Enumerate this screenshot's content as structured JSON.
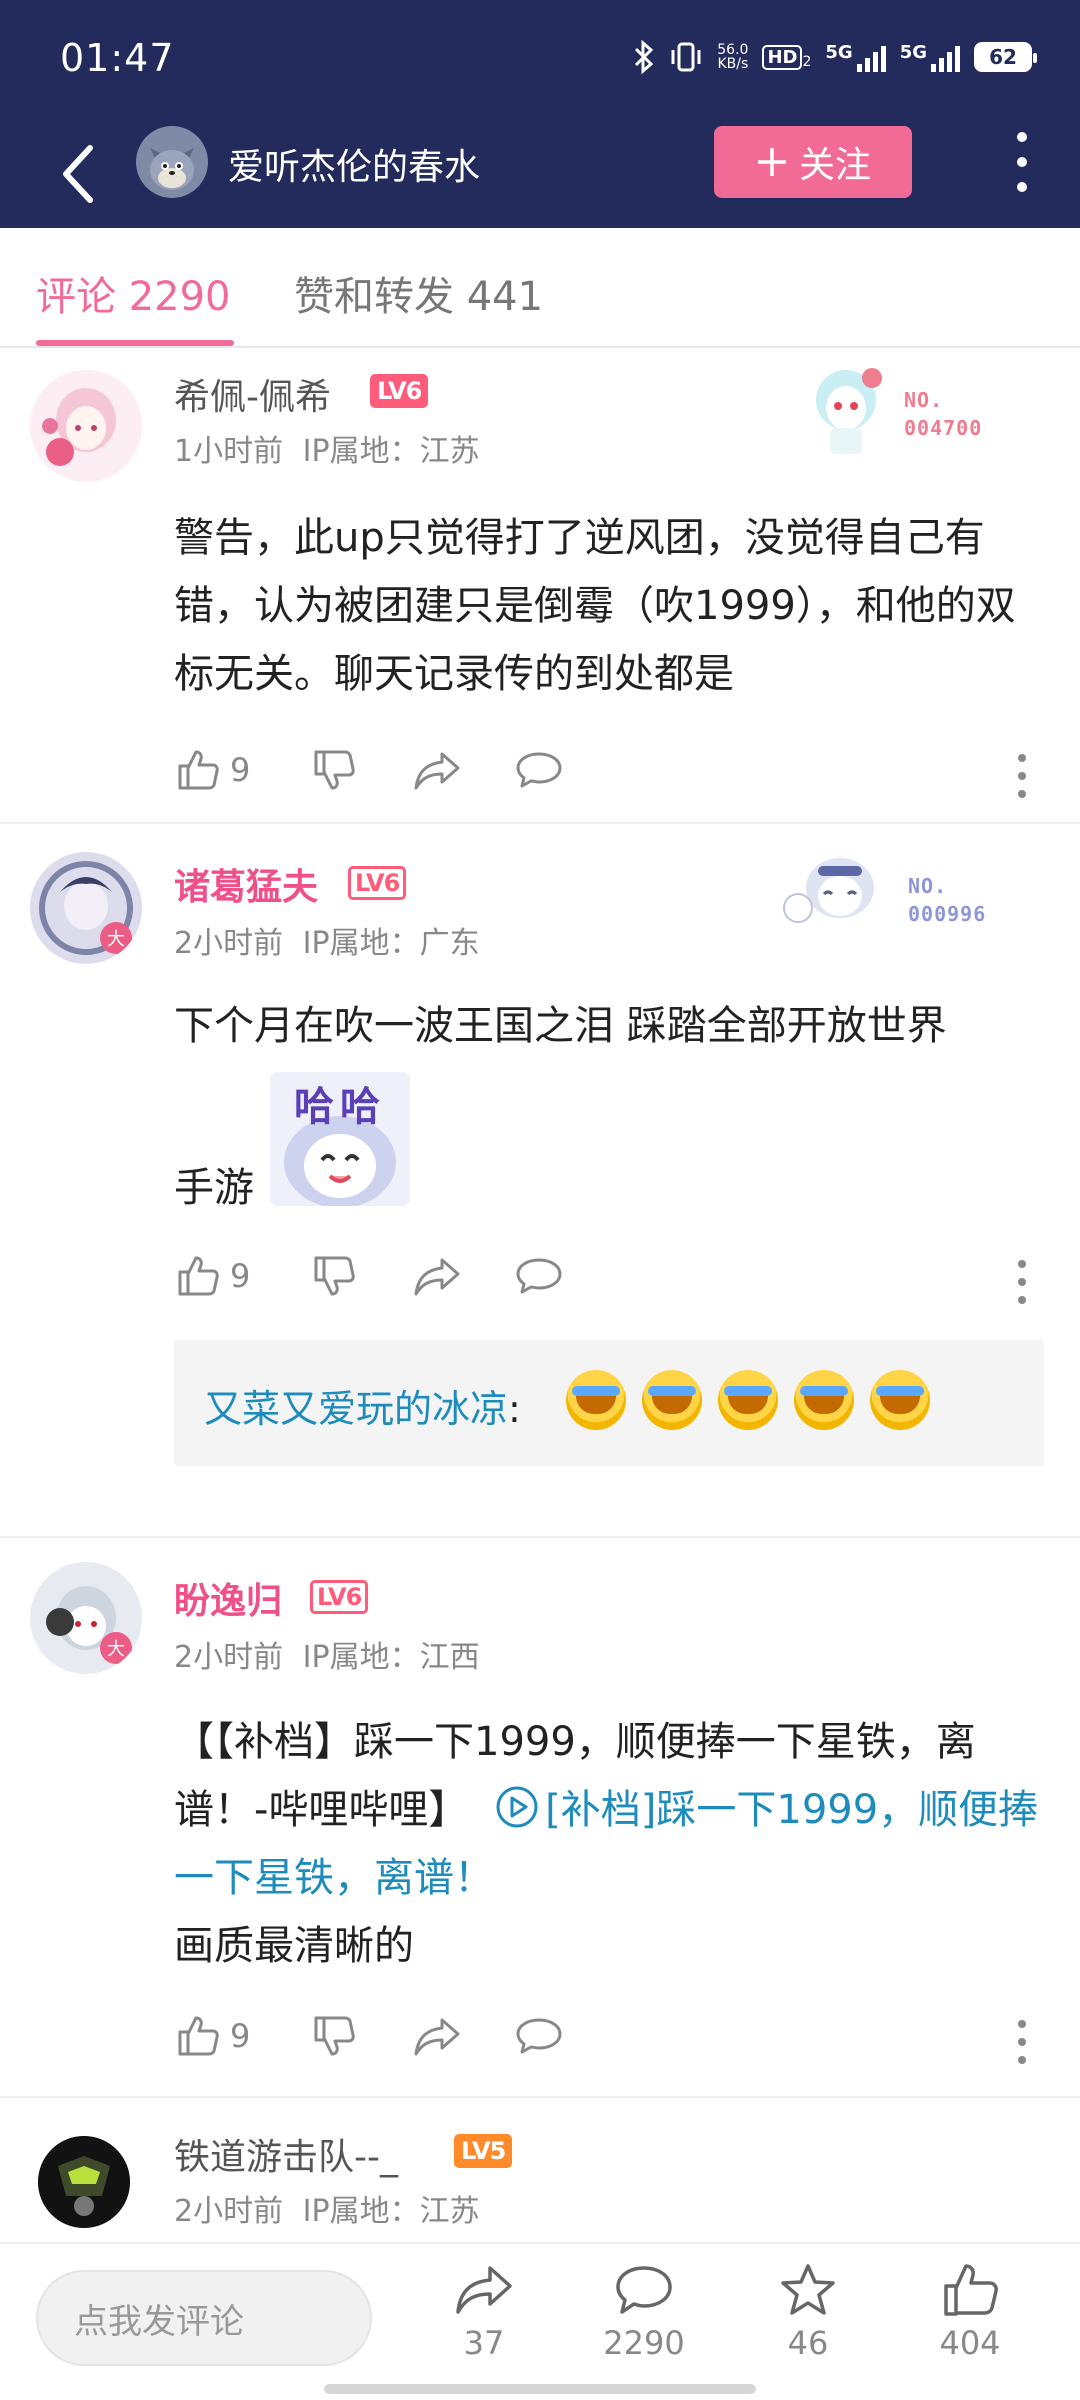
{
  "status_bar": {
    "time": "01:47",
    "net_speed_value": "56.0",
    "net_speed_unit": "KB/s",
    "hd_label": "HD",
    "hd_sub": "2",
    "net1": "5G",
    "net2": "5G",
    "battery": "62"
  },
  "header": {
    "user_name": "爱听杰伦的春水",
    "follow_label": "关注"
  },
  "tabs": [
    {
      "label": "评论 2290",
      "active": true
    },
    {
      "label": "赞和转发 441",
      "active": false
    }
  ],
  "comments": [
    {
      "user": "希佩-佩希",
      "level": "LV6",
      "time": "1小时前",
      "ip": "IP属地：江苏",
      "badge_no": "NO.",
      "badge_num": "004700",
      "text": "警告，此up只觉得打了逆风团，没觉得自己有错，认为被团建只是倒霉（吹1999），和他的双标无关。聊天记录传的到处都是",
      "likes": "9"
    },
    {
      "user": "诸葛猛夫",
      "level": "LV6",
      "time": "2小时前",
      "ip": "IP属地：广东",
      "badge_no": "NO.",
      "badge_num": "000996",
      "text_line1": "下个月在吹一波王国之泪 踩踏全部开放世界",
      "text_line2": "手游",
      "sticker_text": "哈哈",
      "likes": "9",
      "reply": {
        "name": "又菜又爱玩的冰凉",
        "sep": ":"
      }
    },
    {
      "user": "盼逸归",
      "level": "LV6",
      "time": "2小时前",
      "ip": "IP属地：江西",
      "text_part1": "【【补档】踩一下1999，顺便捧一下星铁，离谱！-哔哩哔哩】",
      "link_text": "[补档]踩一下1999，顺便捧一下星铁，离谱！",
      "text_part2": "画质最清晰的",
      "likes": "9"
    },
    {
      "user": "铁道游击队--_",
      "level": "LV5",
      "time": "2小时前",
      "ip": "IP属地：江苏"
    }
  ],
  "bottom_bar": {
    "input_placeholder": "点我发评论",
    "share_count": "37",
    "comment_count": "2290",
    "fav_count": "46",
    "like_count": "404"
  },
  "colors": {
    "header_bg": "#232a5c",
    "accent_pink": "#f26b97",
    "link_blue": "#1e8bbd",
    "level_red": "#ff5b7a",
    "level_orange": "#ff8a2a"
  }
}
